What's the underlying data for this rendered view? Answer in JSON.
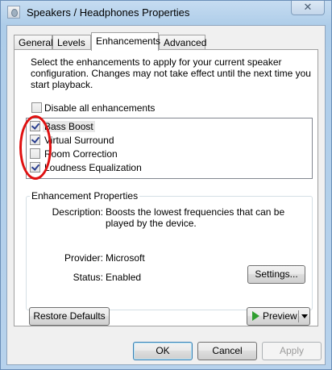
{
  "window": {
    "title": "Speakers / Headphones Properties",
    "close_glyph": "✕"
  },
  "tabs": [
    {
      "label": "General"
    },
    {
      "label": "Levels"
    },
    {
      "label": "Enhancements"
    },
    {
      "label": "Advanced"
    }
  ],
  "active_tab": "Enhancements",
  "description": "Select the enhancements to apply for your current speaker configuration. Changes may not take effect until the next time you start playback.",
  "disable_all": {
    "label": "Disable all enhancements",
    "checked": false
  },
  "enhancements": [
    {
      "label": "Bass Boost",
      "checked": true,
      "selected": true
    },
    {
      "label": "Virtual Surround",
      "checked": true,
      "selected": false
    },
    {
      "label": "Room Correction",
      "checked": false,
      "selected": false
    },
    {
      "label": "Loudness Equalization",
      "checked": true,
      "selected": false
    }
  ],
  "properties": {
    "group_title": "Enhancement Properties",
    "description_label": "Description:",
    "description_value": "Boosts the lowest frequencies that can be played by the device.",
    "provider_label": "Provider:",
    "provider_value": "Microsoft",
    "status_label": "Status:",
    "status_value": "Enabled",
    "settings_button": "Settings..."
  },
  "buttons": {
    "restore_defaults": "Restore Defaults",
    "preview": "Preview",
    "ok": "OK",
    "cancel": "Cancel",
    "apply": "Apply"
  },
  "colors": {
    "annotation": "#e01010",
    "play_icon": "#2f9e2f",
    "window_frame": "#aecde9"
  }
}
